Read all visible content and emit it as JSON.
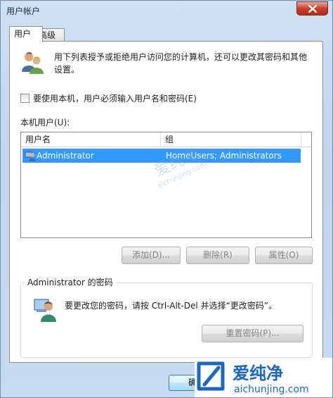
{
  "window": {
    "title": "用户帐户"
  },
  "tabs": [
    {
      "label": "用户"
    },
    {
      "label": "高级"
    }
  ],
  "info_text": "用下列表授予或拒绝用户访问您的计算机，还可以更改其密码和其他设置。",
  "require_login_checkbox": {
    "label": "要使用本机，用户必须输入用户名和密码(E)",
    "checked": false
  },
  "users_list": {
    "label": "本机用户(U):",
    "columns": [
      "用户名",
      "组"
    ],
    "rows": [
      {
        "user": "Administrator",
        "group": "HomeUsers; Administrators",
        "selected": true
      }
    ]
  },
  "buttons": {
    "add": "添加(D)...",
    "remove": "删除(R)",
    "properties": "属性(O)",
    "reset_password": "重置密码(P)...",
    "ok": "确定"
  },
  "password_group": {
    "title": "Administrator 的密码",
    "text": "要更改您的密码，请按 Ctrl-Alt-Del 并选择“更改密码”。"
  },
  "watermark": {
    "brand": "爱纯净",
    "site": "aichunjing.com"
  },
  "colors": {
    "selection": "#3399ff",
    "close_button": "#c7402d",
    "logo_blue": "#1a66c4"
  }
}
